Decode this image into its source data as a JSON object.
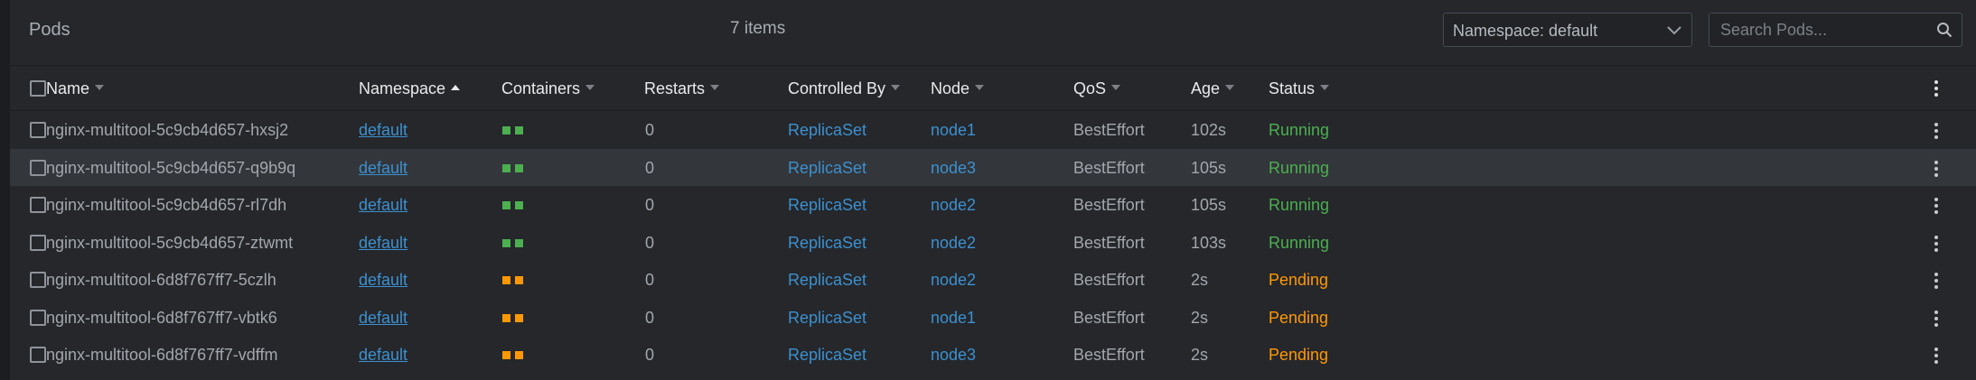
{
  "header": {
    "title": "Pods",
    "item_count": "7 items",
    "namespace_select": "Namespace: default",
    "search_placeholder": "Search Pods..."
  },
  "columns": [
    "Name",
    "Namespace",
    "Containers",
    "Restarts",
    "Controlled By",
    "Node",
    "QoS",
    "Age",
    "Status"
  ],
  "sort": {
    "column": "Namespace",
    "direction": "ascending"
  },
  "colors": {
    "running": "#4caf50",
    "pending": "#ff9800",
    "link": "#3d90ce",
    "selected_row": "#33363b"
  },
  "icons": {
    "search": "search-icon",
    "dropdown": "chevron-down-icon",
    "menu": "kebab-menu-icon"
  },
  "rows": [
    {
      "name": "nginx-multitool-5c9cb4d657-hxsj2",
      "namespace": "default",
      "containers": [
        "running",
        "running"
      ],
      "restarts": "0",
      "controlled_by": "ReplicaSet",
      "node": "node1",
      "qos": "BestEffort",
      "age": "102s",
      "status": "Running",
      "selected": false
    },
    {
      "name": "nginx-multitool-5c9cb4d657-q9b9q",
      "namespace": "default",
      "containers": [
        "running",
        "running"
      ],
      "restarts": "0",
      "controlled_by": "ReplicaSet",
      "node": "node3",
      "qos": "BestEffort",
      "age": "105s",
      "status": "Running",
      "selected": true
    },
    {
      "name": "nginx-multitool-5c9cb4d657-rl7dh",
      "namespace": "default",
      "containers": [
        "running",
        "running"
      ],
      "restarts": "0",
      "controlled_by": "ReplicaSet",
      "node": "node2",
      "qos": "BestEffort",
      "age": "105s",
      "status": "Running",
      "selected": false
    },
    {
      "name": "nginx-multitool-5c9cb4d657-ztwmt",
      "namespace": "default",
      "containers": [
        "running",
        "running"
      ],
      "restarts": "0",
      "controlled_by": "ReplicaSet",
      "node": "node2",
      "qos": "BestEffort",
      "age": "103s",
      "status": "Running",
      "selected": false
    },
    {
      "name": "nginx-multitool-6d8f767ff7-5czlh",
      "namespace": "default",
      "containers": [
        "pending",
        "pending"
      ],
      "restarts": "0",
      "controlled_by": "ReplicaSet",
      "node": "node2",
      "qos": "BestEffort",
      "age": "2s",
      "status": "Pending",
      "selected": false
    },
    {
      "name": "nginx-multitool-6d8f767ff7-vbtk6",
      "namespace": "default",
      "containers": [
        "pending",
        "pending"
      ],
      "restarts": "0",
      "controlled_by": "ReplicaSet",
      "node": "node1",
      "qos": "BestEffort",
      "age": "2s",
      "status": "Pending",
      "selected": false
    },
    {
      "name": "nginx-multitool-6d8f767ff7-vdffm",
      "namespace": "default",
      "containers": [
        "pending",
        "pending"
      ],
      "restarts": "0",
      "controlled_by": "ReplicaSet",
      "node": "node3",
      "qos": "BestEffort",
      "age": "2s",
      "status": "Pending",
      "selected": false
    }
  ]
}
